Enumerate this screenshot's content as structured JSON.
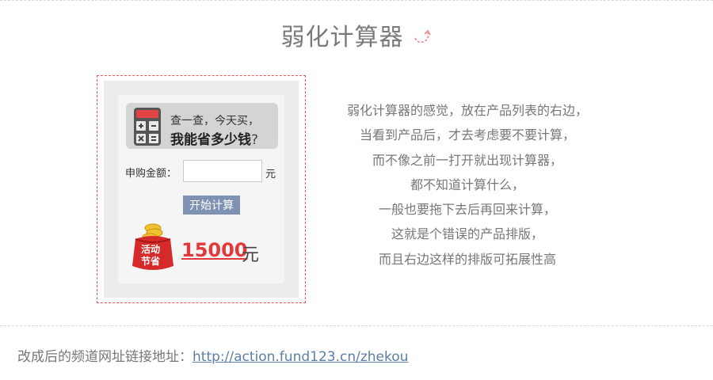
{
  "header": {
    "title": "弱化计算器"
  },
  "widget": {
    "promo_line1": "查一查，今天买，",
    "promo_line2": "我能省多少钱",
    "promo_question": "?",
    "amount_label": "申购金额：",
    "amount_value": "",
    "amount_unit": "元",
    "start_button": "开始计算",
    "badge_line1": "活动",
    "badge_line2": "节省",
    "saving_value": "15000",
    "saving_unit": "元"
  },
  "description": {
    "lines": [
      "弱化计算器的感觉，放在产品列表的右边，",
      "当看到产品后，才去考虑要不要计算，",
      "而不像之前一打开就出现计算器，",
      "都不知道计算什么，",
      "一般也要拖下去后再回来计算，",
      "这就是个错误的产品排版，",
      "而且右边这样的排版可拓展性高"
    ]
  },
  "footer": {
    "label": "改成后的频道网址链接地址：",
    "link_text": "http://action.fund123.cn/zhekou"
  },
  "colors": {
    "accent_red": "#e03a3a",
    "button_blue": "#7f92b3",
    "link_blue": "#5b7fa6"
  },
  "icons": [
    "curved-arrow-icon",
    "calculator-icon",
    "money-bag-icon"
  ]
}
